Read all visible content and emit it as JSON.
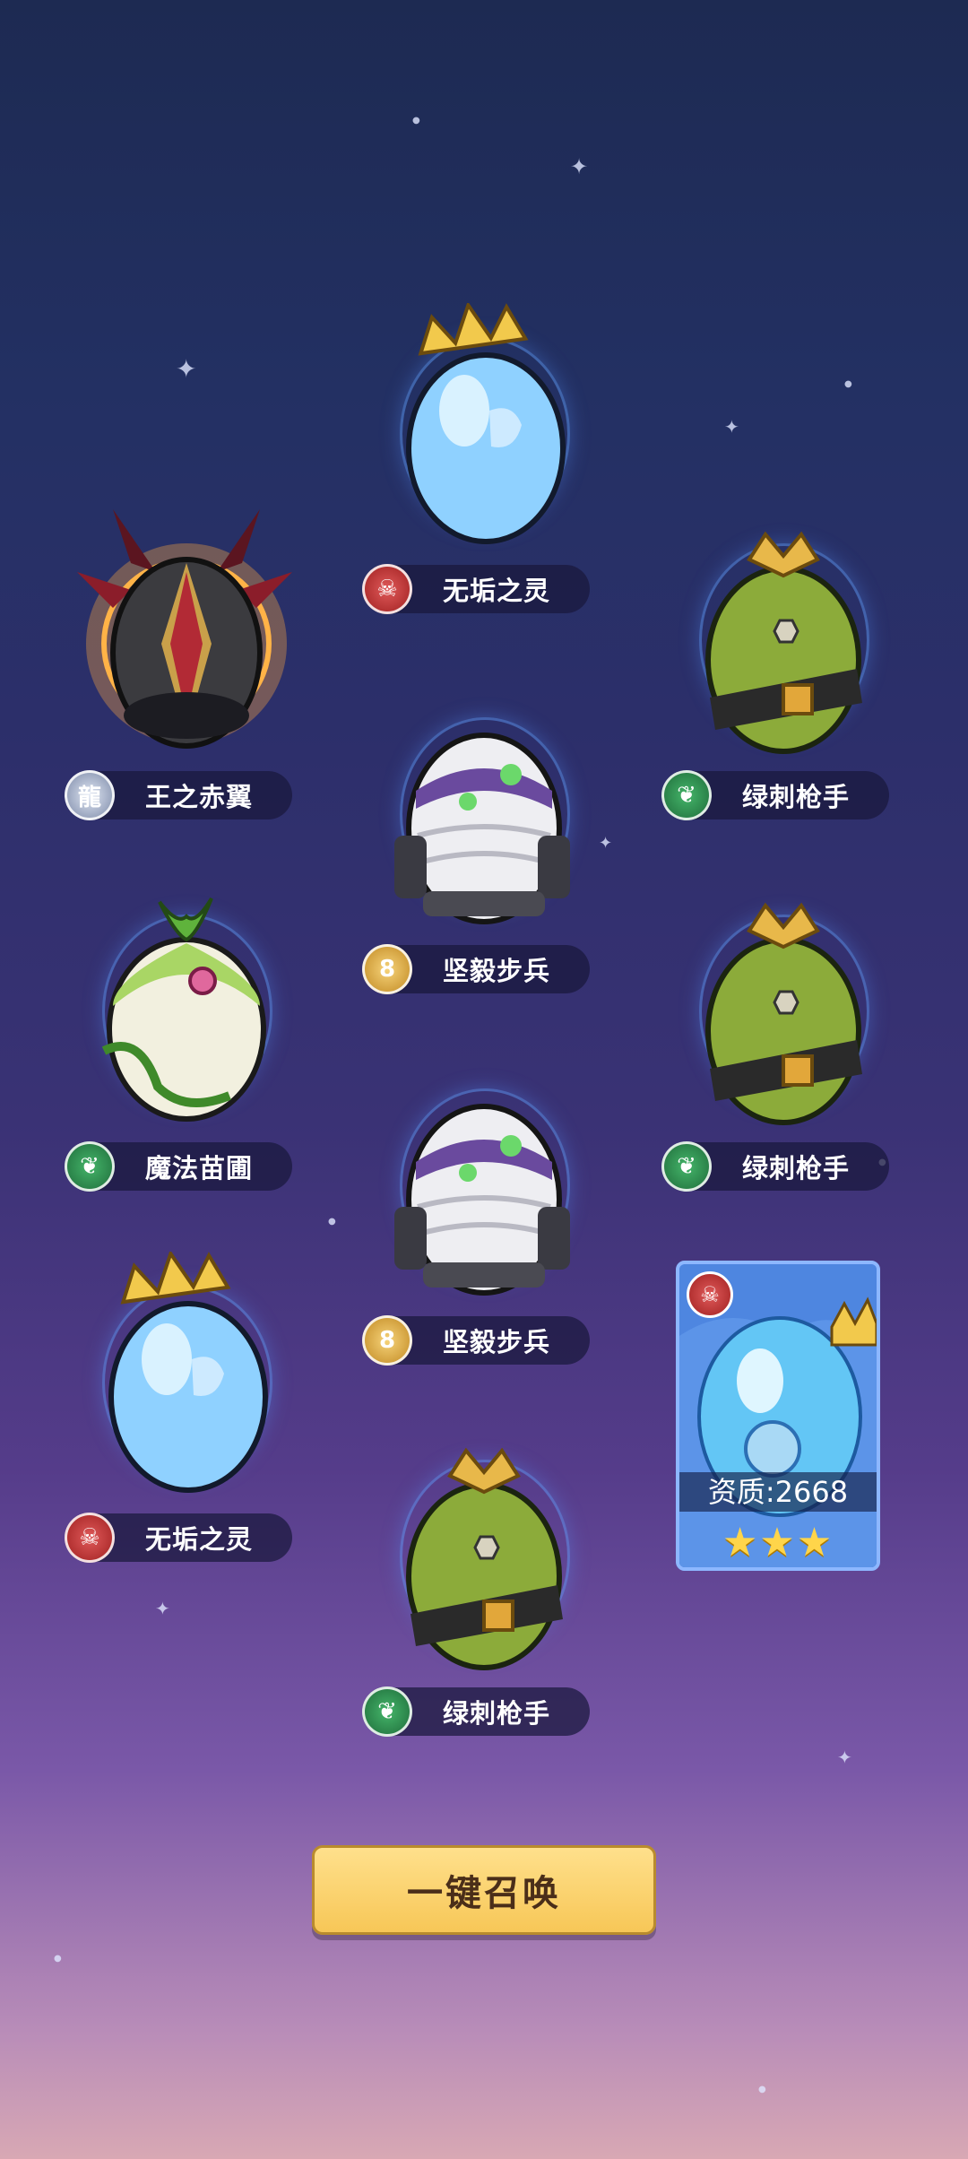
{
  "slots": [
    {
      "name": "王之赤翼",
      "badge_icon": "dragon-icon",
      "egg": "crimson-wing-egg"
    },
    {
      "name": "无垢之灵",
      "badge_icon": "skull-icon",
      "egg": "crowned-blue-egg"
    },
    {
      "name": "绿刺枪手",
      "badge_icon": "leaf-icon",
      "egg": "cactus-egg"
    },
    {
      "name": "坚毅步兵",
      "badge_icon": "gear-icon",
      "egg": "mummy-egg"
    },
    {
      "name": "魔法苗圃",
      "badge_icon": "leaf-icon",
      "egg": "vine-egg"
    },
    {
      "name": "绿刺枪手",
      "badge_icon": "leaf-icon",
      "egg": "cactus-egg"
    },
    {
      "name": "坚毅步兵",
      "badge_icon": "gear-icon",
      "egg": "mummy-egg"
    },
    {
      "name": "无垢之灵",
      "badge_icon": "skull-icon",
      "egg": "crowned-blue-egg"
    },
    {
      "name": "绿刺枪手",
      "badge_icon": "leaf-icon",
      "egg": "cactus-egg"
    }
  ],
  "card": {
    "stat": "资质:2668",
    "stars": "★★★",
    "stars_count": 3,
    "badge_icon": "skull-icon"
  },
  "summon_button": {
    "label": "一键召唤"
  },
  "colors": {
    "button": "#f7c757",
    "plate": "#19183c",
    "card": "#3d6fcf"
  }
}
